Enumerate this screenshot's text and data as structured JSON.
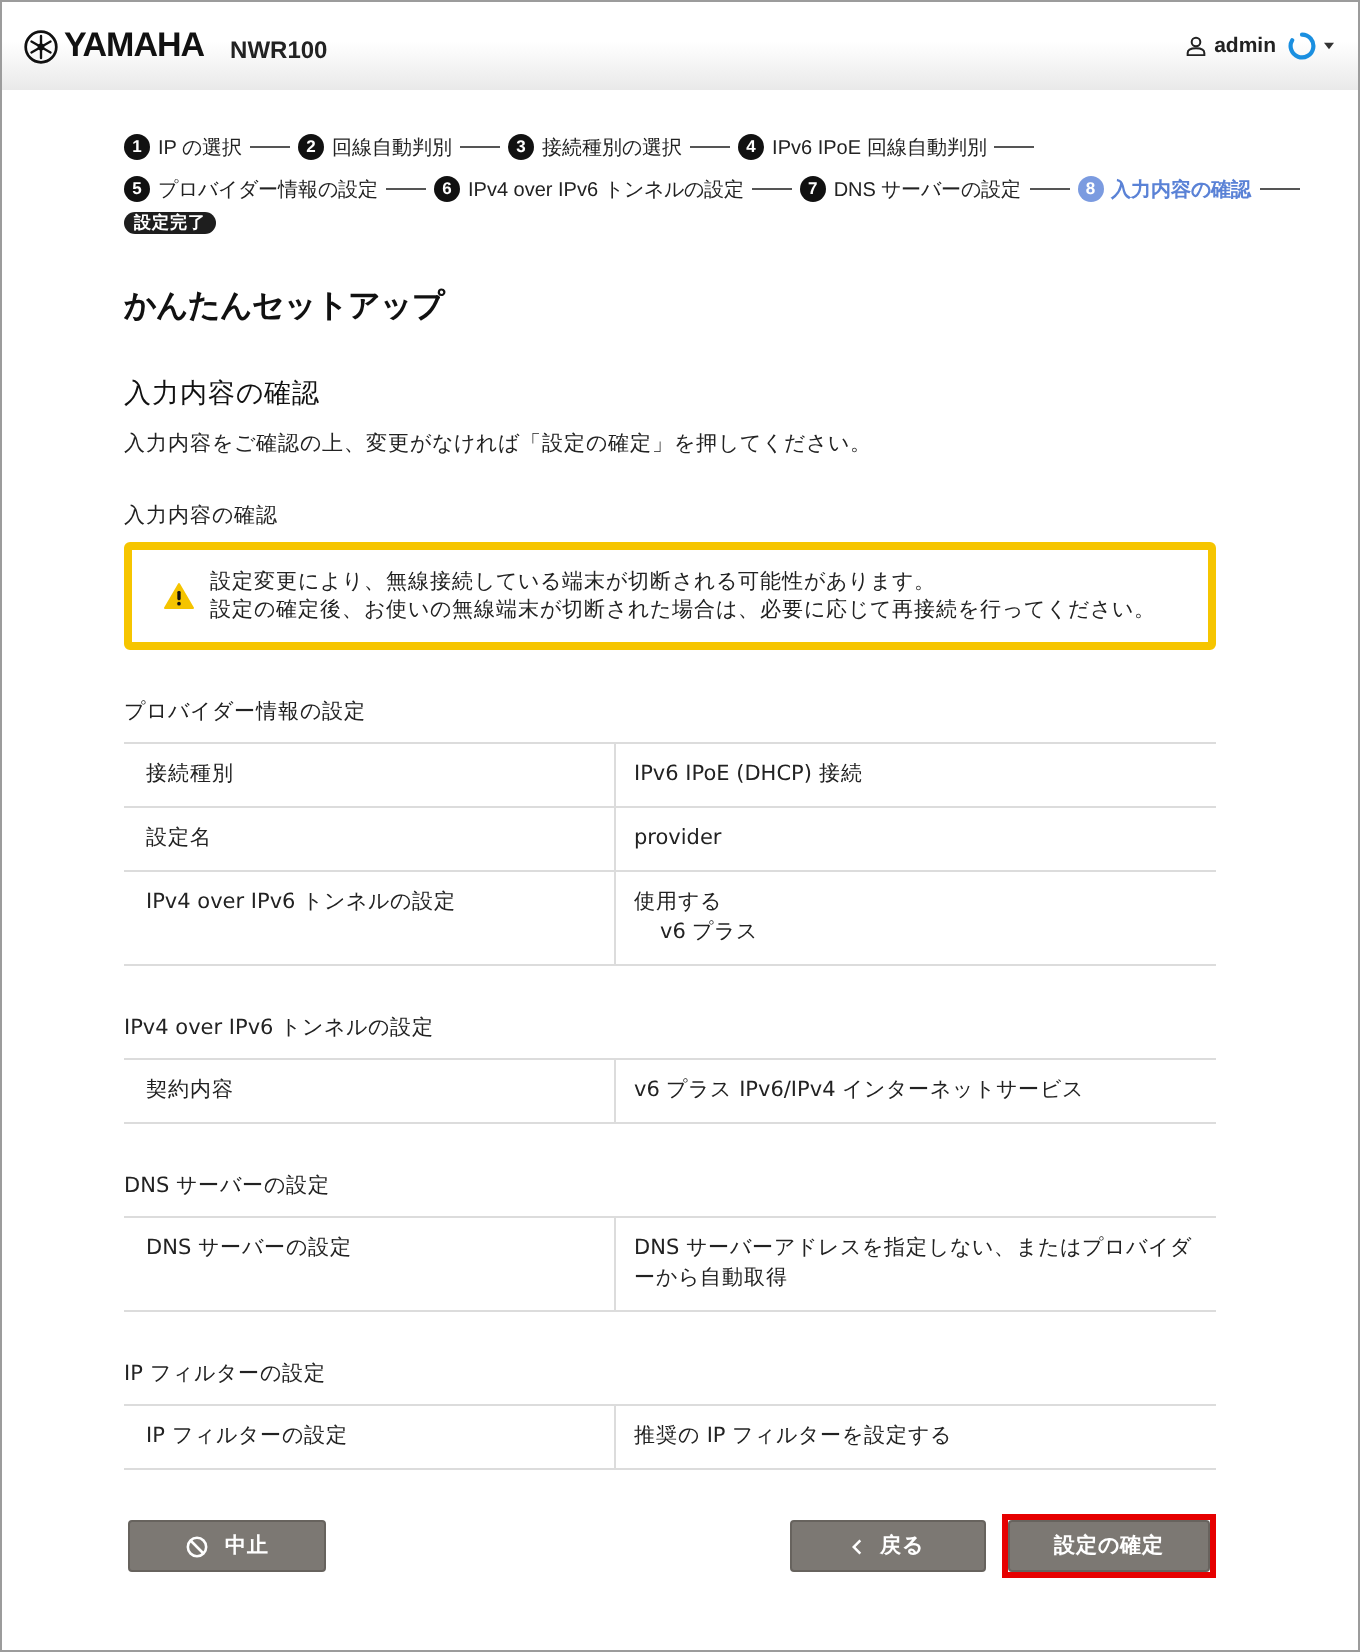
{
  "header": {
    "brand": "YAMAHA",
    "model": "NWR100",
    "user": "admin"
  },
  "progress": {
    "lines": [
      {
        "steps": [
          {
            "number": "1",
            "label": "IP の選択",
            "current": false
          },
          {
            "number": "2",
            "label": "回線自動判別",
            "current": false
          },
          {
            "number": "3",
            "label": "接続種別の選択",
            "current": false
          },
          {
            "number": "4",
            "label": "IPv6 IPoE 回線自動判別",
            "current": false
          }
        ]
      },
      {
        "steps": [
          {
            "number": "5",
            "label": "プロバイダー情報の設定",
            "current": false
          },
          {
            "number": "6",
            "label": "IPv4 over IPv6 トンネルの設定",
            "current": false
          },
          {
            "number": "7",
            "label": "DNS サーバーの設定",
            "current": false
          },
          {
            "number": "8",
            "label": "入力内容の確認",
            "current": true
          }
        ]
      }
    ],
    "completion": "設定完了"
  },
  "page_title": "かんたんセットアップ",
  "section_title": "入力内容の確認",
  "description": "入力内容をご確認の上、変更がなければ「設定の確定」を押してください。",
  "review_label": "入力内容の確認",
  "warning": {
    "lines": [
      "設定変更により、無線接続している端末が切断される可能性があります。",
      "設定の確定後、お使いの無線端末が切断された場合は、必要に応じて再接続を行ってください。"
    ]
  },
  "groups": [
    {
      "title": "プロバイダー情報の設定",
      "rows": [
        {
          "label": "接続種別",
          "value": "IPv6 IPoE (DHCP) 接続"
        },
        {
          "label": "設定名",
          "value": "provider"
        },
        {
          "label": "IPv4 over IPv6 トンネルの設定",
          "value": "使用する",
          "detail": "v6 プラス"
        }
      ]
    },
    {
      "title": "IPv4 over IPv6 トンネルの設定",
      "rows": [
        {
          "label": "契約内容",
          "value": "v6 プラス IPv6/IPv4 インターネットサービス"
        }
      ]
    },
    {
      "title": "DNS サーバーの設定",
      "rows": [
        {
          "label": "DNS サーバーの設定",
          "value": "DNS サーバーアドレスを指定しない、またはプロバイダーから自動取得"
        }
      ]
    },
    {
      "title": "IP フィルターの設定",
      "rows": [
        {
          "label": "IP フィルターの設定",
          "value": "推奨の IP フィルターを設定する"
        }
      ]
    }
  ],
  "buttons": [
    {
      "label": "中止",
      "kind": "cancel",
      "highlighted": false
    },
    {
      "label": "戻る",
      "kind": "back",
      "highlighted": false
    },
    {
      "label": "設定の確定",
      "kind": "confirm",
      "highlighted": true
    }
  ]
}
